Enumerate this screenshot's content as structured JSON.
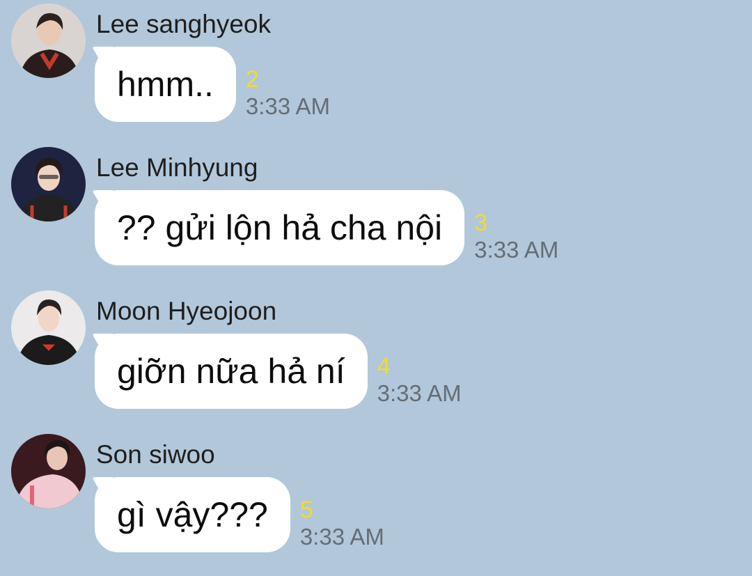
{
  "chat": {
    "messages": [
      {
        "sender": "Lee sanghyeok",
        "text": "hmm..",
        "unread": "2",
        "time": "3:33 AM",
        "avatar_icon": "user-avatar-photo",
        "avatar_bg": "#d9d4d2",
        "avatar_shirt": "#2a1c1c",
        "avatar_accent": "#c43a2e"
      },
      {
        "sender": "Lee Minhyung",
        "text": "?? gửi lộn hả cha nội",
        "unread": "3",
        "time": "3:33 AM",
        "avatar_icon": "user-avatar-photo",
        "avatar_bg": "#1e2340",
        "avatar_shirt": "#222222",
        "avatar_accent": "#c43a2e"
      },
      {
        "sender": "Moon Hyeojoon",
        "text": "giỡn nữa hả ní",
        "unread": "4",
        "time": "3:33 AM",
        "avatar_icon": "user-avatar-photo",
        "avatar_bg": "#eceaea",
        "avatar_shirt": "#1b1b1b",
        "avatar_accent": "#d03a2c"
      },
      {
        "sender": "Son siwoo",
        "text": "gì vậy???",
        "unread": "5",
        "time": "3:33 AM",
        "avatar_icon": "user-avatar-photo",
        "avatar_bg": "#3a1a1e",
        "avatar_shirt": "#f1c9d0",
        "avatar_accent": "#e06478"
      }
    ]
  },
  "colors": {
    "background": "#b2c7da",
    "bubble": "#ffffff",
    "unread": "#f0dc2f",
    "time": "#656d75"
  }
}
